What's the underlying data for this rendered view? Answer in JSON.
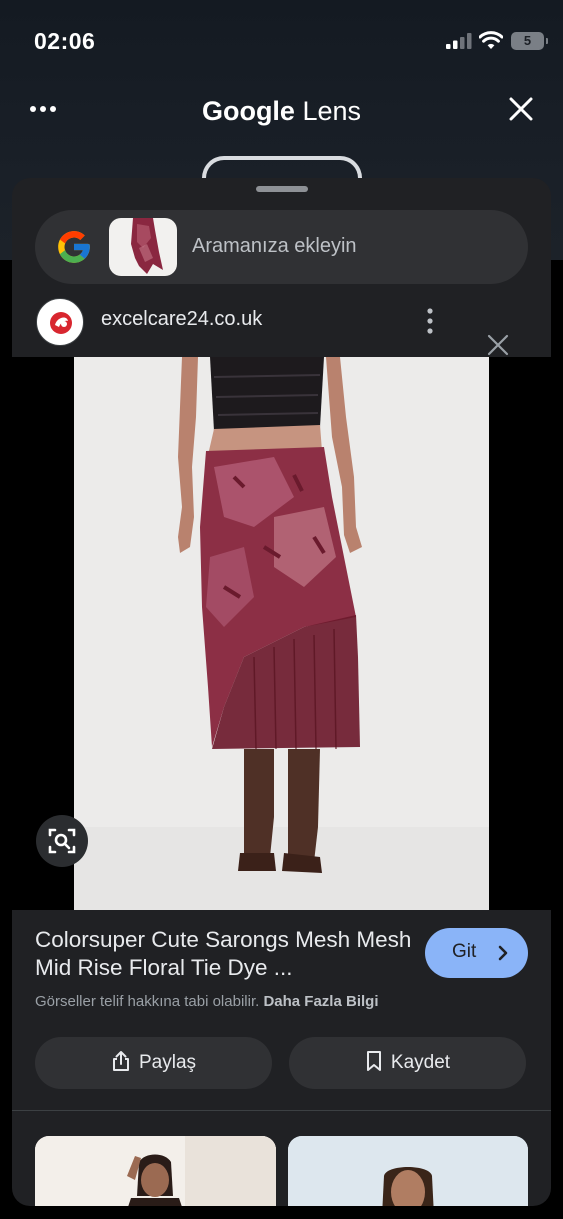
{
  "status_bar": {
    "time": "02:06",
    "battery": "5",
    "signal_icon": "cellular-signal-icon",
    "wifi_icon": "wifi-icon"
  },
  "lens_header": {
    "title_brand": "Google",
    "title_product": "Lens",
    "more_icon": "more-horizontal-icon",
    "close_icon": "close-icon"
  },
  "search": {
    "placeholder": "Aramanıza ekleyin",
    "logo_icon": "google-g-icon"
  },
  "source": {
    "site": "excelcare24.co.uk",
    "favicon_icon": "site-favicon-icon",
    "menu_icon": "more-vertical-icon",
    "close_icon": "close-icon"
  },
  "result": {
    "title": "Colorsuper Cute Sarongs Mesh Mesh Mid Rise Floral Tie Dye ...",
    "go_label": "Git",
    "copyright_text": "Görseller telif hakkına tabi olabilir.",
    "more_info_label": "Daha Fazla Bilgi",
    "share_label": "Paylaş",
    "save_label": "Kaydet"
  },
  "colors": {
    "sheet_bg": "#202124",
    "pill_bg": "#303134",
    "accent_button": "#8ab4f8",
    "skirt": "#7c1f35"
  }
}
